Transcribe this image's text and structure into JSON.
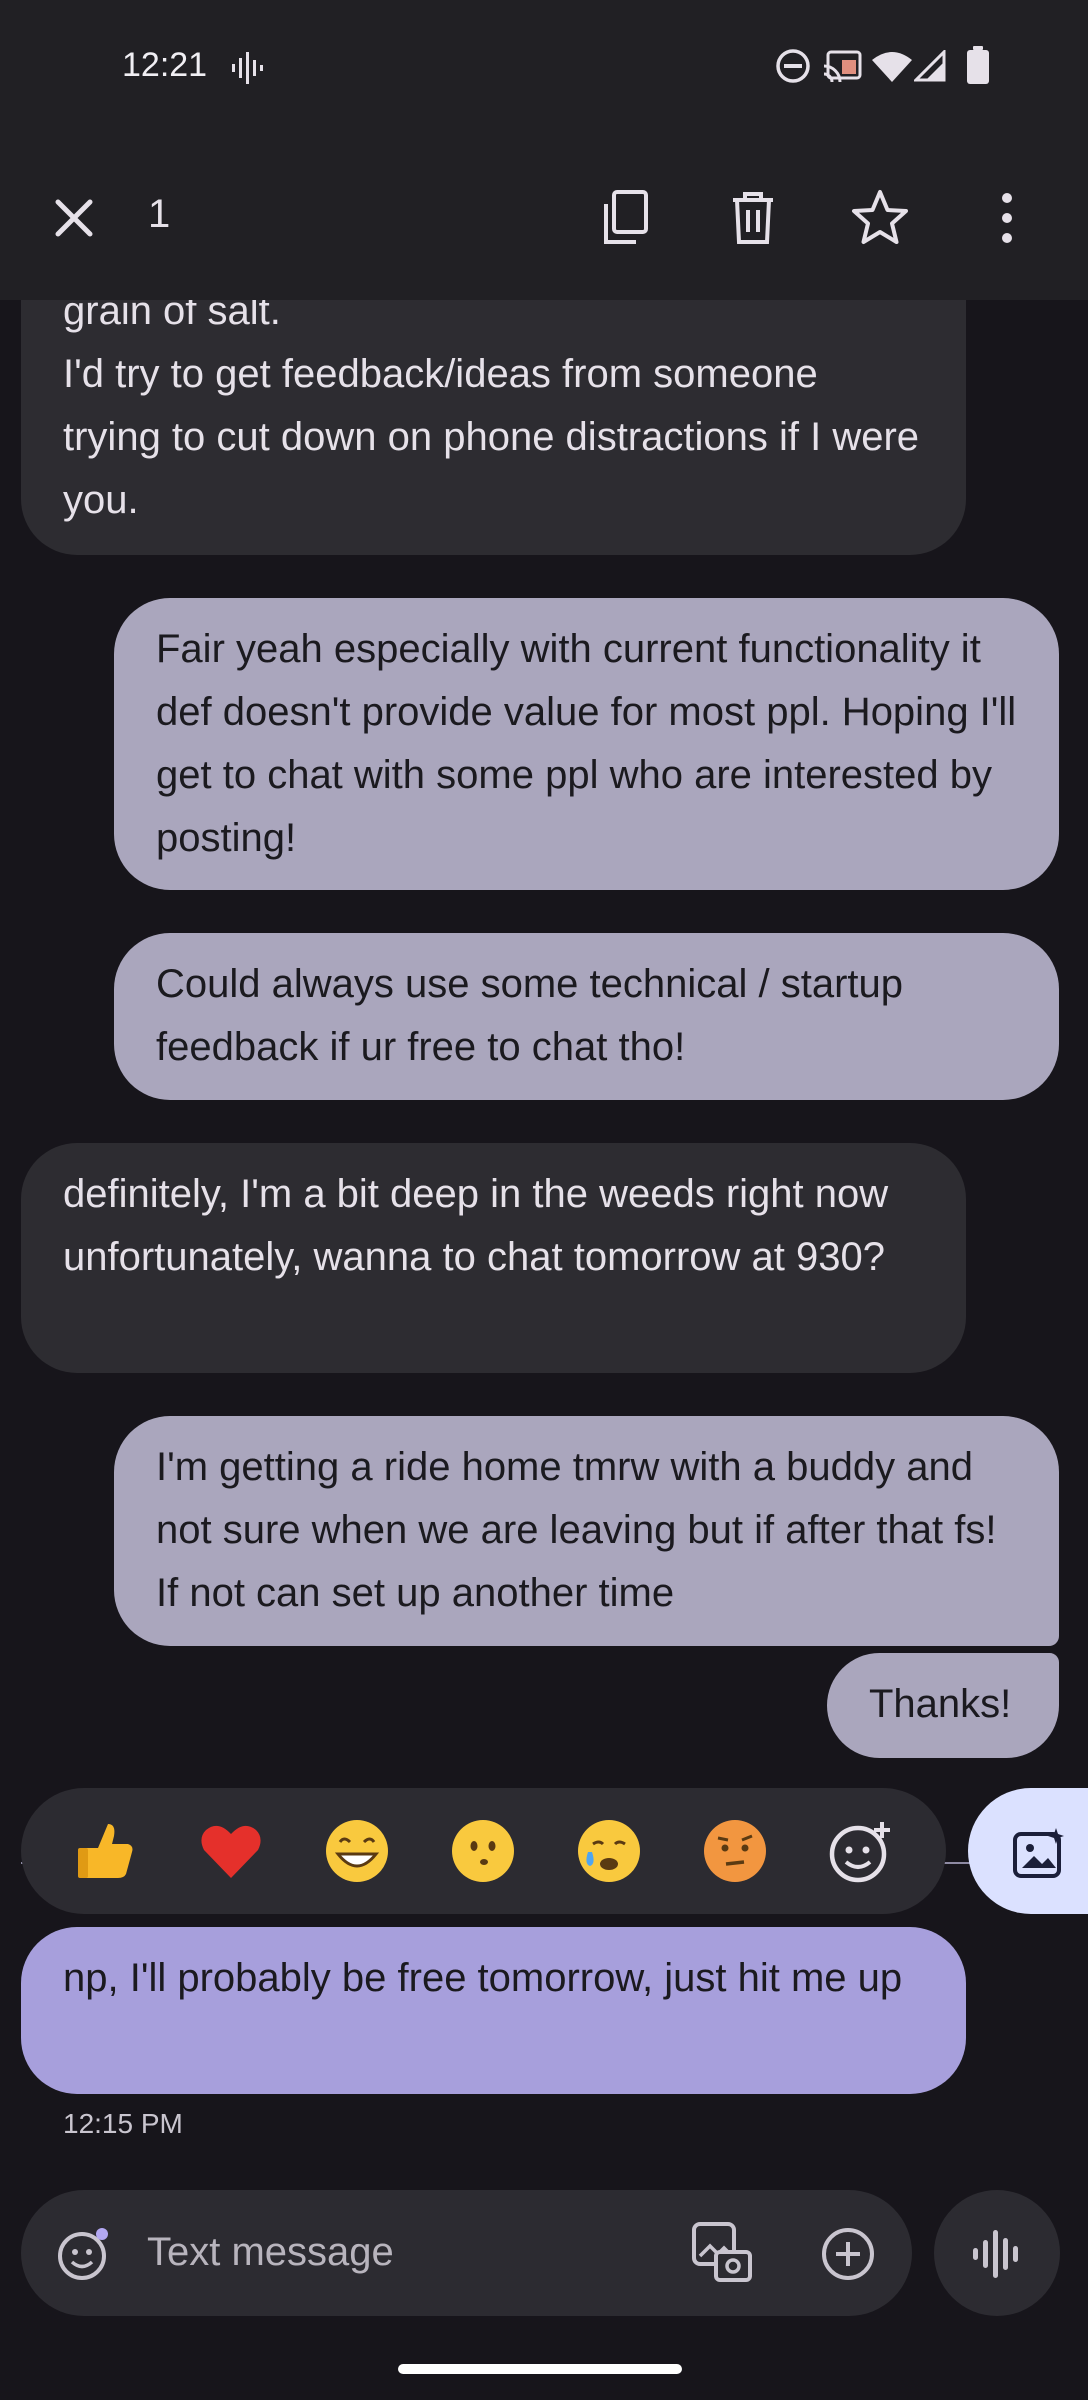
{
  "status": {
    "time": "12:21"
  },
  "action_bar": {
    "selected_count": "1"
  },
  "messages": [
    {
      "side": "incoming",
      "text": "grain of salt.\nI'd try to get feedback/ideas from someone trying to cut down on phone distractions if I were you."
    },
    {
      "side": "outgoing",
      "text": "Fair yeah especially with current functionality it def doesn't provide value for most ppl. Hoping I'll get to chat with some ppl who are interested by posting!"
    },
    {
      "side": "outgoing",
      "text": "Could always use some technical / startup feedback if ur free to chat tho!"
    },
    {
      "side": "incoming",
      "text": "definitely, I'm a bit deep in the weeds right now unfortunately, wanna to chat tomorrow at 930?"
    },
    {
      "side": "outgoing",
      "text": "I'm getting a ride home tmrw with a buddy and not sure when we are leaving but if after that fs! If not can set up another time"
    },
    {
      "side": "outgoing",
      "text": "Thanks!"
    },
    {
      "side": "incoming",
      "text": "np, I'll probably be free tomorrow, just hit me up",
      "selected": true
    }
  ],
  "selected_timestamp": "12:15 PM",
  "reactions": [
    "thumbs-up",
    "red-heart",
    "grinning-face",
    "face-without-mouth",
    "crying-face",
    "raised-eyebrow-face",
    "add-emoji"
  ],
  "compose": {
    "placeholder": "Text message"
  },
  "colors": {
    "background": "#17151b",
    "bar": "#212024",
    "incoming_bubble": "#2d2c31",
    "outgoing_bubble": "#aaa6bd",
    "selected_bubble": "#a79fdc",
    "accent": "#dbe1ff"
  }
}
